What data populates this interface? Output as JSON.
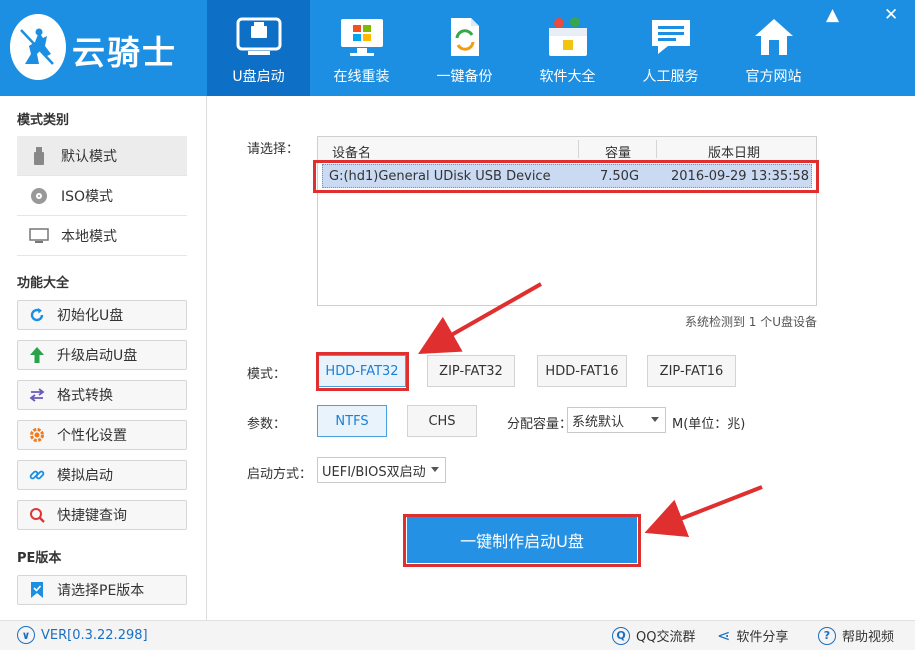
{
  "app": {
    "logo_text": "云骑士"
  },
  "nav": [
    {
      "label": "U盘启动",
      "icon": "usb-drive-icon"
    },
    {
      "label": "在线重装",
      "icon": "monitor-windows-icon"
    },
    {
      "label": "一键备份",
      "icon": "backup-file-icon"
    },
    {
      "label": "软件大全",
      "icon": "software-box-icon"
    },
    {
      "label": "人工服务",
      "icon": "chat-bubble-icon"
    },
    {
      "label": "官方网站",
      "icon": "home-icon"
    }
  ],
  "window": {
    "minimize": "▲",
    "close": "✕"
  },
  "sidebar": {
    "mode_category": "模式类别",
    "modes": [
      {
        "label": "默认模式",
        "icon": "usb-stick-icon"
      },
      {
        "label": "ISO模式",
        "icon": "disc-icon"
      },
      {
        "label": "本地模式",
        "icon": "monitor-icon"
      }
    ],
    "func_category": "功能大全",
    "functions": [
      {
        "label": "初始化U盘",
        "icon": "refresh-icon"
      },
      {
        "label": "升级启动U盘",
        "icon": "arrow-up-icon"
      },
      {
        "label": "格式转换",
        "icon": "swap-arrows-icon"
      },
      {
        "label": "个性化设置",
        "icon": "gear-icon"
      },
      {
        "label": "模拟启动",
        "icon": "link-icon"
      },
      {
        "label": "快捷键查询",
        "icon": "search-icon"
      }
    ],
    "pe_category": "PE版本",
    "pe_button": {
      "label": "请选择PE版本",
      "icon": "bookmark-icon"
    }
  },
  "main": {
    "select_label": "请选择：",
    "table": {
      "headers": [
        "设备名",
        "容量",
        "版本日期"
      ],
      "rows": [
        {
          "name": "G:(hd1)General UDisk USB Device",
          "capacity": "7.50G",
          "date": "2016-09-29 13:35:58"
        }
      ]
    },
    "detected": "系统检测到 1 个U盘设备",
    "mode_label": "模式：",
    "modes": [
      "HDD-FAT32",
      "ZIP-FAT32",
      "HDD-FAT16",
      "ZIP-FAT16"
    ],
    "param_label": "参数：",
    "params": [
      "NTFS",
      "CHS"
    ],
    "alloc_label": "分配容量：",
    "alloc_value": "系统默认",
    "alloc_unit": "M(单位：兆)",
    "boot_label": "启动方式：",
    "boot_value": "UEFI/BIOS双启动",
    "make_button": "一键制作启动U盘"
  },
  "footer": {
    "version": "VER[0.3.22.298]",
    "links": [
      "QQ交流群",
      "软件分享",
      "帮助视频"
    ]
  },
  "colors": {
    "brand": "#1c8fe2",
    "brand_dark": "#0e6fc7",
    "highlight": "#e02f2f",
    "button": "#2491e4"
  }
}
